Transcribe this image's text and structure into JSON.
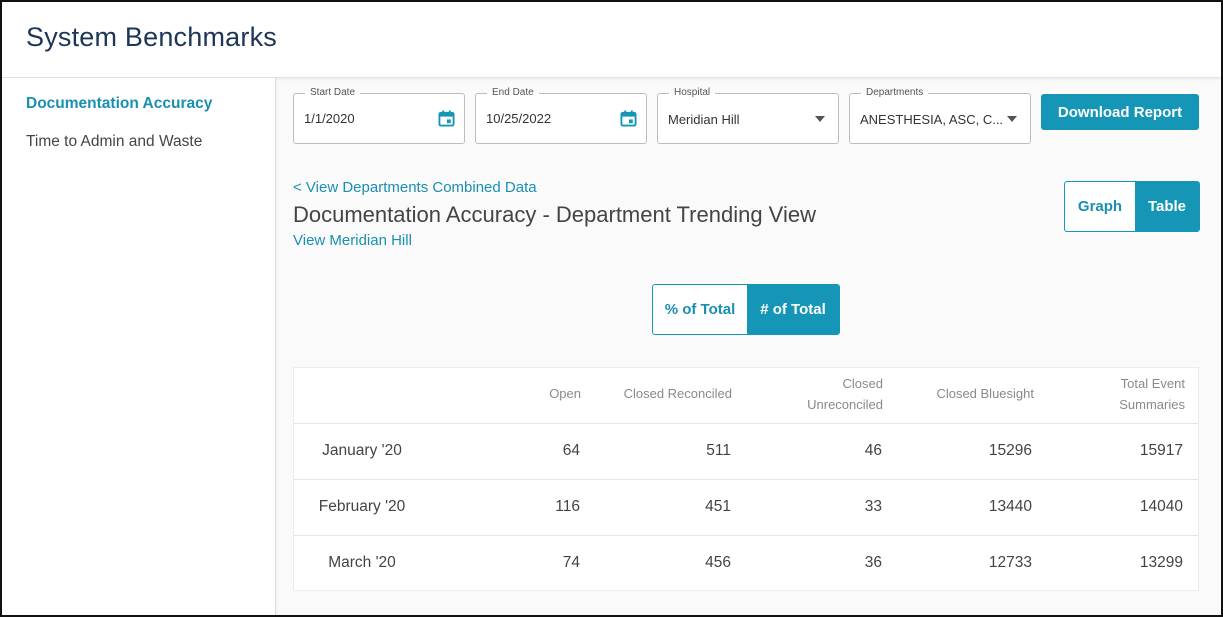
{
  "app": {
    "title": "System Benchmarks"
  },
  "sidebar": {
    "items": [
      {
        "label": "Documentation Accuracy",
        "active": true
      },
      {
        "label": "Time to Admin and Waste",
        "active": false
      }
    ]
  },
  "filters": {
    "start_date": {
      "label": "Start Date",
      "value": "1/1/2020",
      "icon": "calendar-icon"
    },
    "end_date": {
      "label": "End Date",
      "value": "10/25/2022",
      "icon": "calendar-icon"
    },
    "hospital": {
      "label": "Hospital",
      "value": "Meridian Hill"
    },
    "departments": {
      "label": "Departments",
      "value": "ANESTHESIA, ASC, C..."
    },
    "download_label": "Download Report"
  },
  "view": {
    "back_link": "< View Departments Combined Data",
    "title": "Documentation Accuracy - Department Trending View",
    "hospital_link": "View Meridian Hill",
    "mode_toggle": {
      "graph": "Graph",
      "table": "Table",
      "selected": "Table"
    },
    "metric_toggle": {
      "percent": "% of Total",
      "count": "# of Total",
      "selected": "# of Total"
    }
  },
  "table": {
    "columns": [
      "Open",
      "Closed Reconciled",
      "Closed Unreconciled",
      "Closed Bluesight",
      "Total Event Summaries"
    ],
    "rows": [
      {
        "month": "January '20",
        "values": [
          "64",
          "511",
          "46",
          "15296",
          "15917"
        ]
      },
      {
        "month": "February '20",
        "values": [
          "116",
          "451",
          "33",
          "13440",
          "14040"
        ]
      },
      {
        "month": "March '20",
        "values": [
          "74",
          "456",
          "36",
          "12733",
          "13299"
        ]
      }
    ]
  },
  "colors": {
    "accent": "#1696b7",
    "title": "#1d3557"
  }
}
